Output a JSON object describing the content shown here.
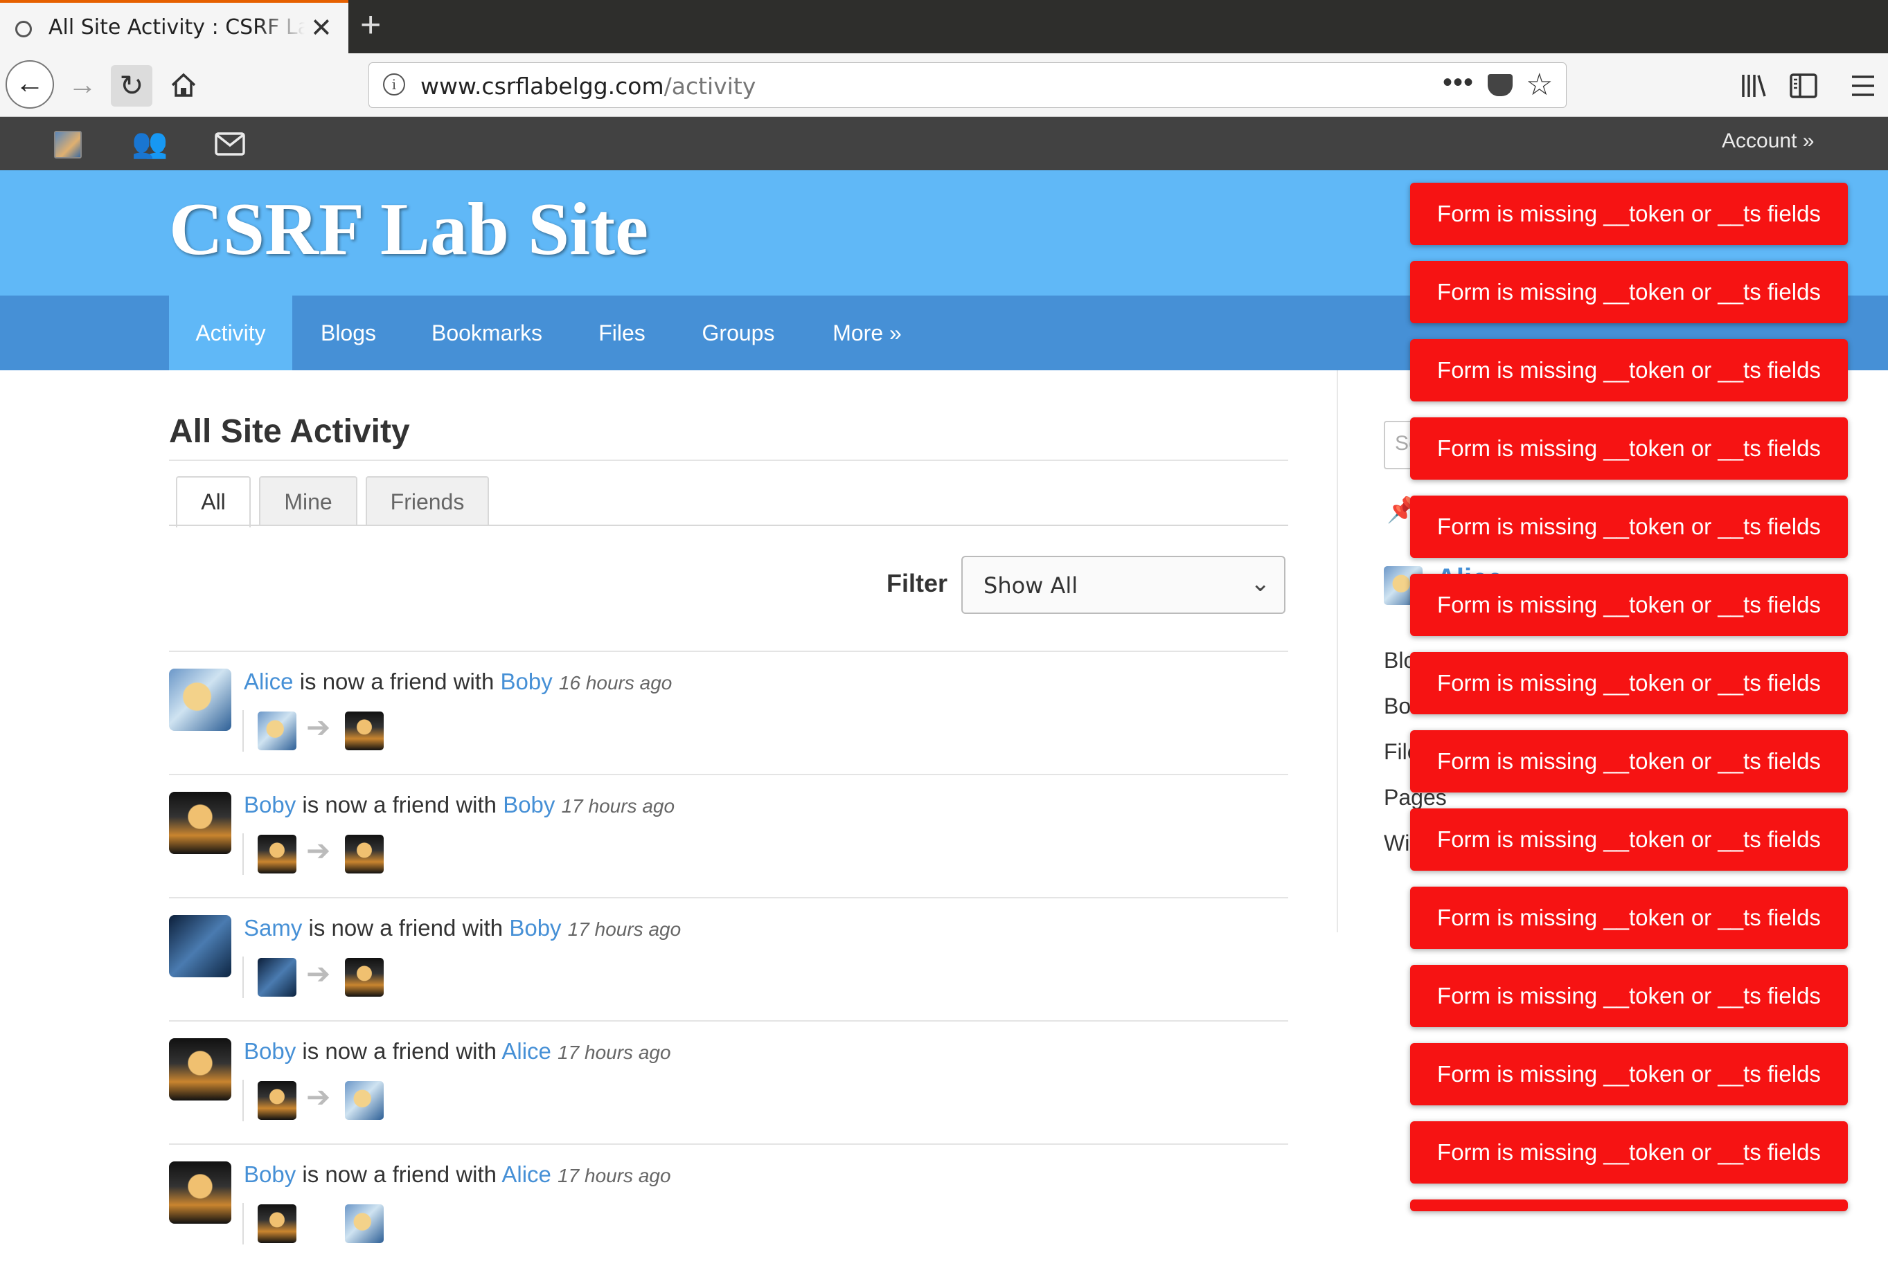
{
  "browser": {
    "tab_title": "All Site Activity : CSRF Lab Site",
    "close_glyph": "✕",
    "new_tab_glyph": "+",
    "url_host": "www.csrflabelgg.com",
    "url_path": "/activity",
    "icons": [
      "back-arrow-icon",
      "forward-arrow-icon",
      "reload-icon",
      "home-icon",
      "info-icon",
      "page-actions-icon",
      "pocket-icon",
      "bookmark-star-icon",
      "library-icon",
      "sidebar-icon",
      "hamburger-menu-icon"
    ]
  },
  "topbar": {
    "account_label": "Account »",
    "icons": [
      "user-avatar-icon",
      "friends-icon",
      "messages-envelope-icon"
    ]
  },
  "header": {
    "site_title": "CSRF Lab Site",
    "nav": [
      {
        "label": "Activity",
        "active": true
      },
      {
        "label": "Blogs"
      },
      {
        "label": "Bookmarks"
      },
      {
        "label": "Files"
      },
      {
        "label": "Groups"
      },
      {
        "label": "More »"
      }
    ]
  },
  "main": {
    "title": "All Site Activity",
    "tabs": [
      "All",
      "Mine",
      "Friends"
    ],
    "filter_label": "Filter",
    "filter_value": "Show All",
    "activities": [
      {
        "actor": "Alice",
        "verb": " is now a friend with ",
        "target": "Boby",
        "time": "16 hours ago",
        "from": "alice",
        "to": "boby"
      },
      {
        "actor": "Boby",
        "verb": " is now a friend with ",
        "target": "Boby",
        "time": "17 hours ago",
        "from": "boby",
        "to": "boby"
      },
      {
        "actor": "Samy",
        "verb": " is now a friend with ",
        "target": "Boby",
        "time": "17 hours ago",
        "from": "samy",
        "to": "boby"
      },
      {
        "actor": "Boby",
        "verb": " is now a friend with ",
        "target": "Alice",
        "time": "17 hours ago",
        "from": "boby",
        "to": "alice"
      },
      {
        "actor": "Boby",
        "verb": " is now a friend with ",
        "target": "Alice",
        "time": "17 hours ago",
        "from": "boby",
        "to": "alice"
      }
    ]
  },
  "sidebar": {
    "search_placeholder": "Se",
    "owner_name": "Alice",
    "links": [
      "Blogs",
      "Bookmarks",
      "Files",
      "Pages",
      "Wire posts"
    ]
  },
  "errors": {
    "message": "Form is missing __token or __ts fields",
    "count": 13
  },
  "colors": {
    "header_blue": "#60b8f7",
    "nav_blue": "#4690d6",
    "topbar": "#424242",
    "error_red": "#f61313",
    "link_blue": "#4690d6"
  }
}
